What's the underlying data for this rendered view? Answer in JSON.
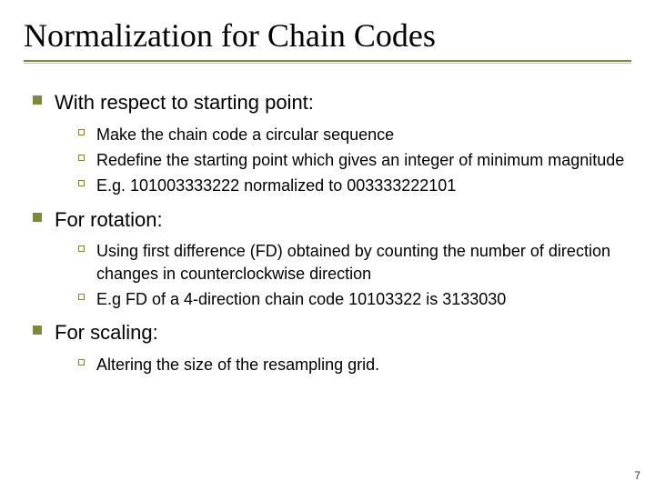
{
  "title": "Normalization for Chain Codes",
  "bullets": [
    {
      "text": "With respect to starting point:",
      "sub": [
        "Make the chain code a circular sequence",
        "Redefine the starting point which gives an integer of minimum magnitude",
        "E.g. 101003333222 normalized to 003333222101"
      ]
    },
    {
      "text": "For rotation:",
      "sub": [
        "Using first difference (FD) obtained by counting the number of direction changes in counterclockwise direction",
        "E.g FD of a 4-direction chain code 10103322 is 3133030"
      ]
    },
    {
      "text": "For scaling:",
      "sub": [
        "Altering the size of the resampling grid."
      ]
    }
  ],
  "page_number": "7"
}
